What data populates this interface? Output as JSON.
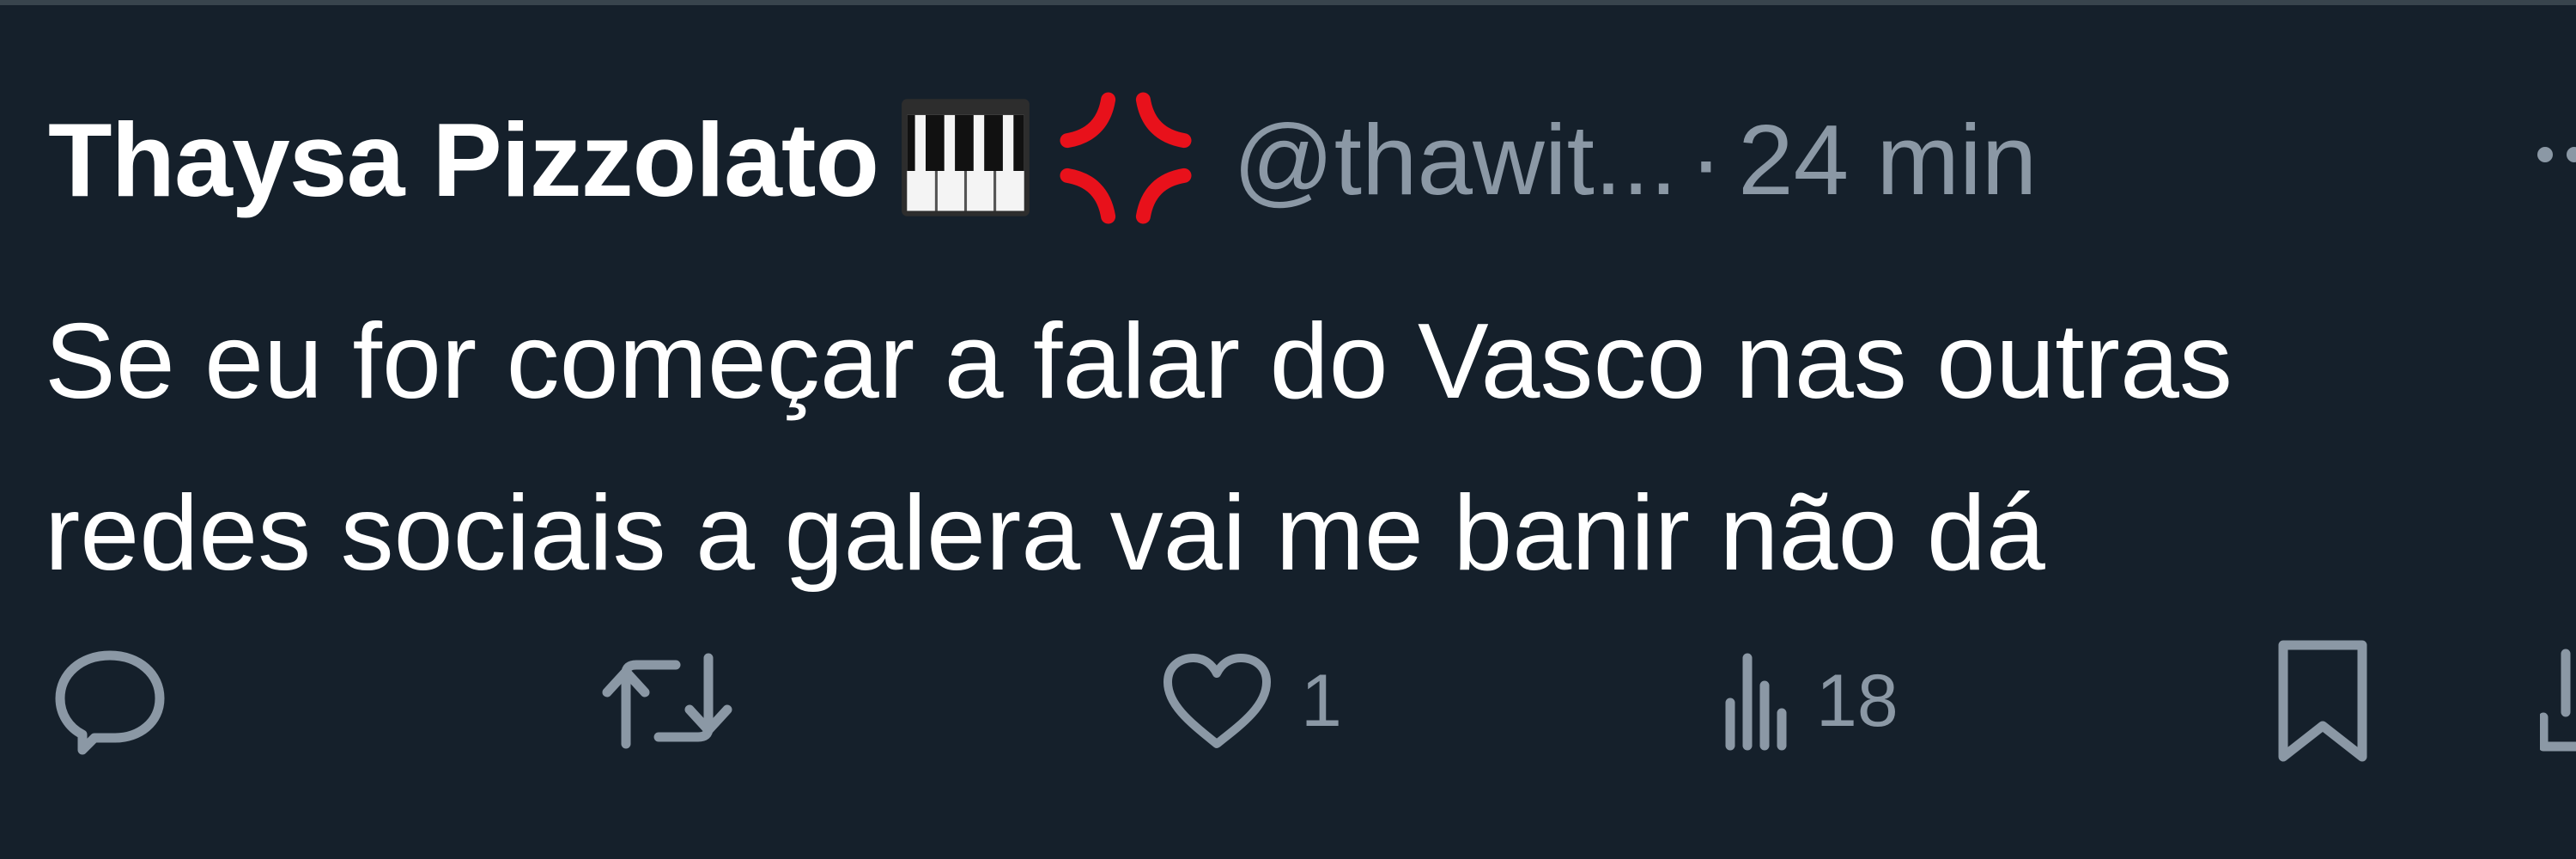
{
  "tweet": {
    "author": {
      "display_name": "Thaysa Pizzolato",
      "handle": "@thawit...",
      "emojis": [
        "piano-keyboard-emoji",
        "anger-symbol-emoji"
      ]
    },
    "separator": "·",
    "timestamp": "24 min",
    "text_lines": [
      "Se eu for começar a falar do Vasco nas outras",
      "redes sociais a galera vai me banir não dá"
    ],
    "actions": {
      "reply": {
        "icon": "reply-icon",
        "count": ""
      },
      "retweet": {
        "icon": "retweet-icon",
        "count": ""
      },
      "like": {
        "icon": "heart-icon",
        "count": "1"
      },
      "views": {
        "icon": "views-icon",
        "count": "18"
      },
      "bookmark": {
        "icon": "bookmark-icon",
        "count": ""
      },
      "share": {
        "icon": "share-icon",
        "count": ""
      }
    }
  },
  "colors": {
    "background": "#15202b",
    "text_primary": "#ffffff",
    "text_secondary": "#8b98a5",
    "divider": "#38444d",
    "anger_red": "#e8111b"
  }
}
